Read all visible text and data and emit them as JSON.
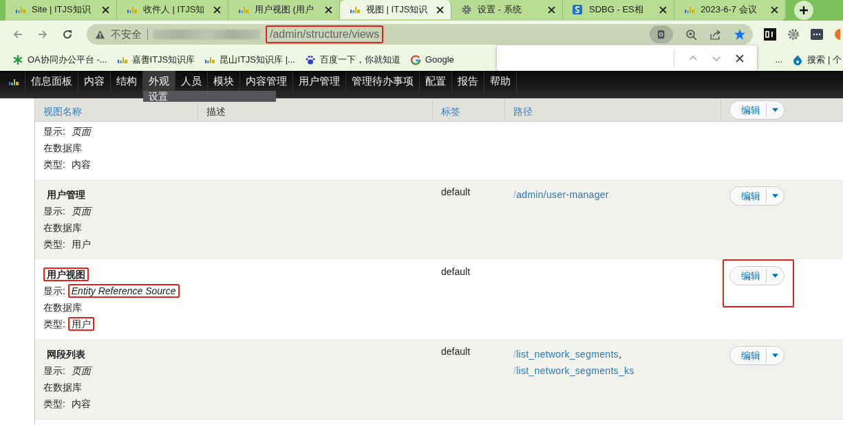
{
  "browser_tabs": [
    {
      "title": "Site | ITJS知识",
      "kind": "logo",
      "selected": false
    },
    {
      "title": "收件人 | ITJS知",
      "kind": "logo",
      "selected": false
    },
    {
      "title": "用户视图 (用户",
      "kind": "logo",
      "selected": false
    },
    {
      "title": "视图 | ITJS知识",
      "kind": "logo",
      "selected": true
    },
    {
      "title": "设置 - 系统",
      "kind": "gear",
      "selected": false
    },
    {
      "title": "SDBG - ES相",
      "kind": "sharepoint",
      "selected": false
    },
    {
      "title": "2023-6-7 会议",
      "kind": "logo",
      "selected": false
    }
  ],
  "address_bar": {
    "security": "不安全",
    "url": "/admin/structure/views",
    "url_highlighted": true
  },
  "bookmarks": [
    {
      "label": "OA协同办公平台 -...",
      "kind": "snowflake"
    },
    {
      "label": "嘉善ITJS知识库",
      "kind": "logo"
    },
    {
      "label": "昆山ITJS知识库 |...",
      "kind": "logo"
    },
    {
      "label": "百度一下，你就知道",
      "kind": "paw"
    },
    {
      "label": "Google",
      "kind": "google"
    },
    {
      "label": "...",
      "kind": "none"
    },
    {
      "label": "搜索 | 个",
      "kind": "drupal"
    }
  ],
  "admin_menu": [
    {
      "label": "信息面板",
      "expanded": false
    },
    {
      "label": "内容",
      "expanded": false
    },
    {
      "label": "结构",
      "expanded": false
    },
    {
      "label": "外观",
      "expanded": true,
      "children": [
        "设置"
      ]
    },
    {
      "label": "人员",
      "expanded": false
    },
    {
      "label": "模块",
      "expanded": false
    },
    {
      "label": "内容管理",
      "expanded": false
    },
    {
      "label": "用户管理",
      "expanded": false
    },
    {
      "label": "管理待办事项",
      "expanded": false
    },
    {
      "label": "配置",
      "expanded": false
    },
    {
      "label": "报告",
      "expanded": false
    },
    {
      "label": "帮助",
      "expanded": false
    }
  ],
  "table": {
    "columns": [
      "视图名称",
      "描述",
      "标签",
      "路径"
    ],
    "header_edit_button": "编辑",
    "rows": [
      {
        "display_label": "显示:",
        "display": "页面",
        "storage": "在数据库",
        "type_label": "类型:",
        "type": "内容"
      },
      {
        "name": "用户管理",
        "display_label": "显示:",
        "display": "页面",
        "storage": "在数据库",
        "type_label": "类型:",
        "type": "用户",
        "tag": "default",
        "paths": [
          "/admin/user-manager"
        ],
        "edit": "编辑"
      },
      {
        "name": "用户视图",
        "name_highlighted": true,
        "display_label": "显示:",
        "display": "Entity Reference Source",
        "display_highlighted": true,
        "storage": "在数据库",
        "type_label": "类型:",
        "type": "用户",
        "type_highlighted": true,
        "tag": "default",
        "paths": [],
        "edit": "编辑",
        "edit_highlighted": true
      },
      {
        "name": "网段列表",
        "display_label": "显示:",
        "display": "页面",
        "storage": "在数据库",
        "type_label": "类型:",
        "type": "内容",
        "tag": "default",
        "paths": [
          "/list_network_segments",
          "/list_network_segments_ks"
        ],
        "path_separator": ",",
        "edit": "编辑"
      }
    ]
  }
}
